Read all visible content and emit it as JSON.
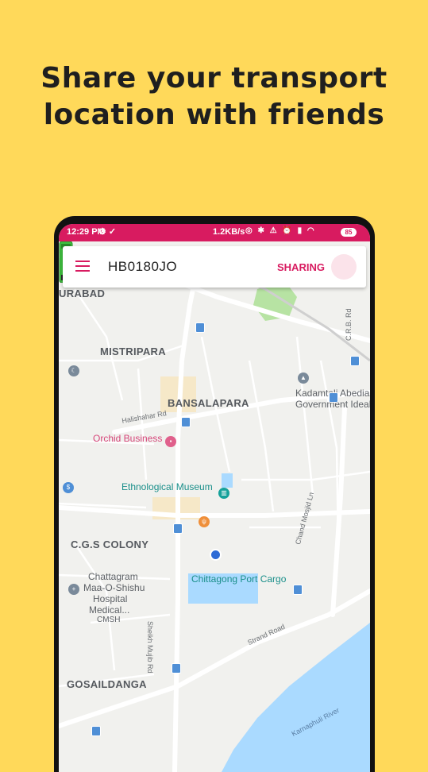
{
  "headline": {
    "line1": "Share your transport",
    "line2": "location with friends"
  },
  "status_bar": {
    "time": "12:29 PM",
    "net_speed": "1.2KB/s",
    "battery": "85"
  },
  "app_bar": {
    "title": "HB0180JO",
    "sharing_label": "SHARING"
  },
  "map": {
    "areas": {
      "urabad": "URABAD",
      "mistripara": "MISTRIPARA",
      "bansalapara": "BANSALAPARA",
      "cgs_colony": "C.G.S COLONY",
      "gosaildanga": "GOSAILDANGA"
    },
    "places": {
      "kadamtali_1": "Kadamtali Abedia",
      "kadamtali_2": "Government Ideal",
      "orchid": "Orchid Business",
      "museum": "Ethnological Museum",
      "port_cargo": "Chittagong Port Cargo",
      "hospital_1": "Chattagram",
      "hospital_2": "Maa-O-Shishu",
      "hospital_3": "Hospital",
      "hospital_4": "Medical...",
      "cmsh": "CMSH"
    },
    "roads": {
      "halishahar": "Halishahar Rd",
      "sheikh_mujib": "Sheikh Mujib Rd",
      "strand": "Strand Road",
      "chand_mosjid": "Chand Mosjid Ln",
      "crb": "C.R.B. Rd",
      "karnaphuli": "Karnaphuli River",
      "top_rd": "Rd"
    }
  },
  "colors": {
    "background": "#FFD95A",
    "accent": "#D81B60",
    "vehicle": "#3FBF3F",
    "water": "#aadaff"
  }
}
